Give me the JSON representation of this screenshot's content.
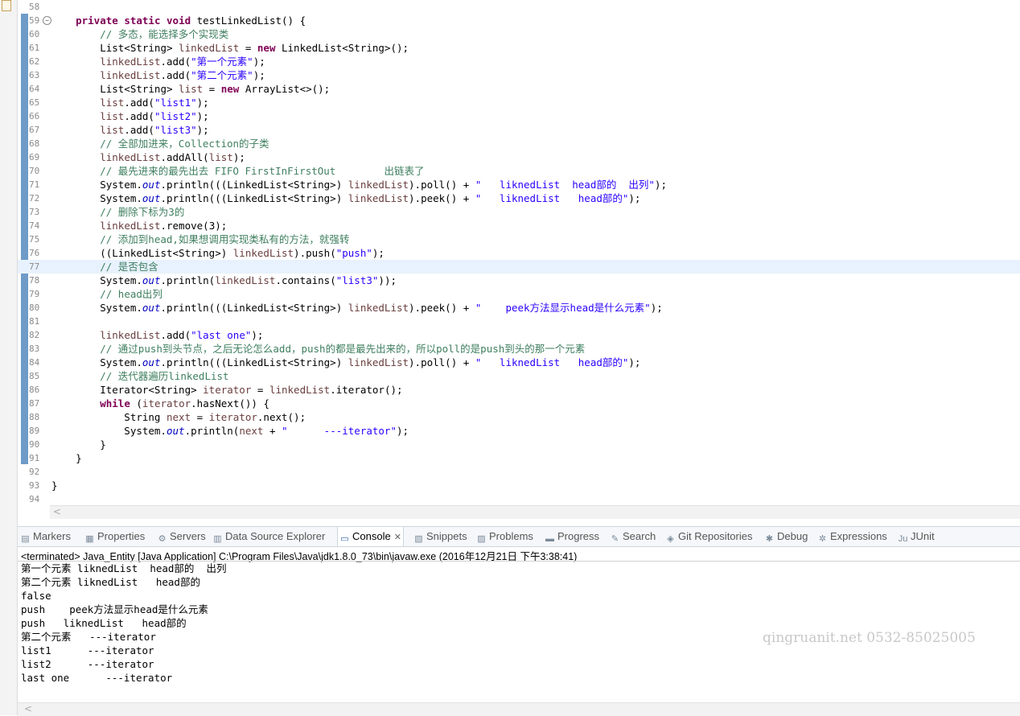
{
  "editor": {
    "current_line": "77",
    "lines": [
      {
        "n": "58",
        "segs": []
      },
      {
        "n": "59",
        "fold": true,
        "segs": [
          {
            "t": "    "
          },
          {
            "t": "private",
            "c": "kw"
          },
          {
            "t": " "
          },
          {
            "t": "static",
            "c": "kw"
          },
          {
            "t": " "
          },
          {
            "t": "void",
            "c": "kw"
          },
          {
            "t": " testLinkedList() {"
          }
        ]
      },
      {
        "n": "60",
        "segs": [
          {
            "t": "        "
          },
          {
            "t": "// 多态，能选择多个实现类",
            "c": "cm"
          }
        ]
      },
      {
        "n": "61",
        "segs": [
          {
            "t": "        List<String> "
          },
          {
            "t": "linkedList",
            "c": "lv"
          },
          {
            "t": " = "
          },
          {
            "t": "new",
            "c": "kw"
          },
          {
            "t": " LinkedList<String>();"
          }
        ]
      },
      {
        "n": "62",
        "segs": [
          {
            "t": "        "
          },
          {
            "t": "linkedList",
            "c": "lv"
          },
          {
            "t": ".add("
          },
          {
            "t": "\"第一个元素\"",
            "c": "st"
          },
          {
            "t": ");"
          }
        ]
      },
      {
        "n": "63",
        "segs": [
          {
            "t": "        "
          },
          {
            "t": "linkedList",
            "c": "lv"
          },
          {
            "t": ".add("
          },
          {
            "t": "\"第二个元素\"",
            "c": "st"
          },
          {
            "t": ");"
          }
        ]
      },
      {
        "n": "64",
        "segs": [
          {
            "t": "        List<String> "
          },
          {
            "t": "list",
            "c": "lv"
          },
          {
            "t": " = "
          },
          {
            "t": "new",
            "c": "kw"
          },
          {
            "t": " ArrayList<>();"
          }
        ]
      },
      {
        "n": "65",
        "segs": [
          {
            "t": "        "
          },
          {
            "t": "list",
            "c": "lv"
          },
          {
            "t": ".add("
          },
          {
            "t": "\"list1\"",
            "c": "st"
          },
          {
            "t": ");"
          }
        ]
      },
      {
        "n": "66",
        "segs": [
          {
            "t": "        "
          },
          {
            "t": "list",
            "c": "lv"
          },
          {
            "t": ".add("
          },
          {
            "t": "\"list2\"",
            "c": "st"
          },
          {
            "t": ");"
          }
        ]
      },
      {
        "n": "67",
        "segs": [
          {
            "t": "        "
          },
          {
            "t": "list",
            "c": "lv"
          },
          {
            "t": ".add("
          },
          {
            "t": "\"list3\"",
            "c": "st"
          },
          {
            "t": ");"
          }
        ]
      },
      {
        "n": "68",
        "segs": [
          {
            "t": "        "
          },
          {
            "t": "// 全部加进来，Collection的子类",
            "c": "cm"
          }
        ]
      },
      {
        "n": "69",
        "segs": [
          {
            "t": "        "
          },
          {
            "t": "linkedList",
            "c": "lv"
          },
          {
            "t": ".addAll("
          },
          {
            "t": "list",
            "c": "lv"
          },
          {
            "t": ");"
          }
        ]
      },
      {
        "n": "70",
        "segs": [
          {
            "t": "        "
          },
          {
            "t": "// 最先进来的最先出去 FIFO FirstInFirstOut        出链表了",
            "c": "cm"
          }
        ]
      },
      {
        "n": "71",
        "segs": [
          {
            "t": "        System."
          },
          {
            "t": "out",
            "c": "fd"
          },
          {
            "t": ".println(((LinkedList<String>) "
          },
          {
            "t": "linkedList",
            "c": "lv"
          },
          {
            "t": ").poll() + "
          },
          {
            "t": "\"   liknedList  head部的  出列\"",
            "c": "st"
          },
          {
            "t": ");"
          }
        ]
      },
      {
        "n": "72",
        "segs": [
          {
            "t": "        System."
          },
          {
            "t": "out",
            "c": "fd"
          },
          {
            "t": ".println(((LinkedList<String>) "
          },
          {
            "t": "linkedList",
            "c": "lv"
          },
          {
            "t": ").peek() + "
          },
          {
            "t": "\"   liknedList   head部的\"",
            "c": "st"
          },
          {
            "t": ");"
          }
        ]
      },
      {
        "n": "73",
        "segs": [
          {
            "t": "        "
          },
          {
            "t": "// 删除下标为3的",
            "c": "cm"
          }
        ]
      },
      {
        "n": "74",
        "segs": [
          {
            "t": "        "
          },
          {
            "t": "linkedList",
            "c": "lv"
          },
          {
            "t": ".remove(3);"
          }
        ]
      },
      {
        "n": "75",
        "segs": [
          {
            "t": "        "
          },
          {
            "t": "// 添加到head,如果想调用实现类私有的方法，就强转",
            "c": "cm"
          }
        ]
      },
      {
        "n": "76",
        "segs": [
          {
            "t": "        ((LinkedList<String>) "
          },
          {
            "t": "linkedList",
            "c": "lv"
          },
          {
            "t": ").push("
          },
          {
            "t": "\"push\"",
            "c": "st"
          },
          {
            "t": ");"
          }
        ]
      },
      {
        "n": "77",
        "segs": [
          {
            "t": "        "
          },
          {
            "t": "// 是否包含",
            "c": "cm"
          }
        ]
      },
      {
        "n": "78",
        "segs": [
          {
            "t": "        System."
          },
          {
            "t": "out",
            "c": "fd"
          },
          {
            "t": ".println("
          },
          {
            "t": "linkedList",
            "c": "lv"
          },
          {
            "t": ".contains("
          },
          {
            "t": "\"list3\"",
            "c": "st"
          },
          {
            "t": "));"
          }
        ]
      },
      {
        "n": "79",
        "segs": [
          {
            "t": "        "
          },
          {
            "t": "// head出列",
            "c": "cm"
          }
        ]
      },
      {
        "n": "80",
        "segs": [
          {
            "t": "        System."
          },
          {
            "t": "out",
            "c": "fd"
          },
          {
            "t": ".println(((LinkedList<String>) "
          },
          {
            "t": "linkedList",
            "c": "lv"
          },
          {
            "t": ").peek() + "
          },
          {
            "t": "\"    peek方法显示head是什么元素\"",
            "c": "st"
          },
          {
            "t": ");"
          }
        ]
      },
      {
        "n": "81",
        "segs": []
      },
      {
        "n": "82",
        "segs": [
          {
            "t": "        "
          },
          {
            "t": "linkedList",
            "c": "lv"
          },
          {
            "t": ".add("
          },
          {
            "t": "\"last one\"",
            "c": "st"
          },
          {
            "t": ");"
          }
        ]
      },
      {
        "n": "83",
        "segs": [
          {
            "t": "        "
          },
          {
            "t": "// 通过push到头节点，之后无论怎么add，push的都是最先出来的，所以poll的是push到头的那一个元素",
            "c": "cm"
          }
        ]
      },
      {
        "n": "84",
        "segs": [
          {
            "t": "        System."
          },
          {
            "t": "out",
            "c": "fd"
          },
          {
            "t": ".println(((LinkedList<String>) "
          },
          {
            "t": "linkedList",
            "c": "lv"
          },
          {
            "t": ").poll() + "
          },
          {
            "t": "\"   liknedList   head部的\"",
            "c": "st"
          },
          {
            "t": ");"
          }
        ]
      },
      {
        "n": "85",
        "segs": [
          {
            "t": "        "
          },
          {
            "t": "// 迭代器遍历linkedList",
            "c": "cm"
          }
        ]
      },
      {
        "n": "86",
        "segs": [
          {
            "t": "        Iterator<String> "
          },
          {
            "t": "iterator",
            "c": "lv"
          },
          {
            "t": " = "
          },
          {
            "t": "linkedList",
            "c": "lv"
          },
          {
            "t": ".iterator();"
          }
        ]
      },
      {
        "n": "87",
        "segs": [
          {
            "t": "        "
          },
          {
            "t": "while",
            "c": "kw"
          },
          {
            "t": " ("
          },
          {
            "t": "iterator",
            "c": "lv"
          },
          {
            "t": ".hasNext()) {"
          }
        ]
      },
      {
        "n": "88",
        "segs": [
          {
            "t": "            String "
          },
          {
            "t": "next",
            "c": "lv"
          },
          {
            "t": " = "
          },
          {
            "t": "iterator",
            "c": "lv"
          },
          {
            "t": ".next();"
          }
        ]
      },
      {
        "n": "89",
        "segs": [
          {
            "t": "            System."
          },
          {
            "t": "out",
            "c": "fd"
          },
          {
            "t": ".println("
          },
          {
            "t": "next",
            "c": "lv"
          },
          {
            "t": " + "
          },
          {
            "t": "\"      ---iterator\"",
            "c": "st"
          },
          {
            "t": ");"
          }
        ]
      },
      {
        "n": "90",
        "segs": [
          {
            "t": "        }"
          }
        ]
      },
      {
        "n": "91",
        "segs": [
          {
            "t": "    }"
          }
        ]
      },
      {
        "n": "92",
        "segs": []
      },
      {
        "n": "93",
        "segs": [
          {
            "t": "}"
          }
        ]
      },
      {
        "n": "94",
        "segs": []
      }
    ]
  },
  "tabs": [
    {
      "label": "Markers",
      "icon": "markers-icon",
      "glyph": "▤"
    },
    {
      "label": "Properties",
      "icon": "properties-icon",
      "glyph": "▦"
    },
    {
      "label": "Servers",
      "icon": "servers-icon",
      "glyph": "⚙"
    },
    {
      "label": "Data Source Explorer",
      "icon": "data-source-icon",
      "glyph": "▥"
    },
    {
      "label": "Console",
      "icon": "console-icon",
      "glyph": "▭",
      "active": true,
      "close": "✕"
    },
    {
      "label": "Snippets",
      "icon": "snippets-icon",
      "glyph": "▧"
    },
    {
      "label": "Problems",
      "icon": "problems-icon",
      "glyph": "▨"
    },
    {
      "label": "Progress",
      "icon": "progress-icon",
      "glyph": "▬"
    },
    {
      "label": "Search",
      "icon": "search-icon",
      "glyph": "✎"
    },
    {
      "label": "Git Repositories",
      "icon": "git-icon",
      "glyph": "◈"
    },
    {
      "label": "Debug",
      "icon": "debug-icon",
      "glyph": "✱"
    },
    {
      "label": "Expressions",
      "icon": "expressions-icon",
      "glyph": "✲"
    },
    {
      "label": "JUnit",
      "icon": "junit-icon",
      "glyph": "Ju"
    }
  ],
  "console": {
    "description": "<terminated> Java_Entity [Java Application] C:\\Program Files\\Java\\jdk1.8.0_73\\bin\\javaw.exe (2016年12月21日 下午3:38:41)",
    "output": [
      "第一个元素 liknedList  head部的  出列",
      "第二个元素 liknedList   head部的",
      "false",
      "push    peek方法显示head是什么元素",
      "push   liknedList   head部的",
      "第二个元素   ---iterator",
      "list1      ---iterator",
      "list2      ---iterator",
      "last one      ---iterator"
    ]
  },
  "watermark": "qingruanit.net 0532-85025005",
  "colors": {
    "ruler": "#6e9bc7",
    "keyword": "#7f0055",
    "comment": "#3f7f5f",
    "string": "#2a00ff",
    "field": "#0000c0",
    "current_line": "#e8f2fe"
  }
}
